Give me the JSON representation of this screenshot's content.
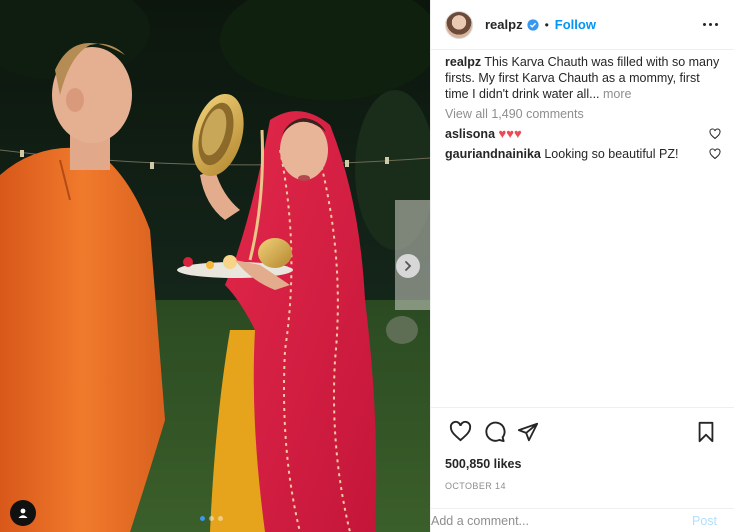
{
  "post": {
    "username": "realpz",
    "follow_label": "Follow",
    "separator": "•",
    "caption_user": "realpz",
    "caption_text": "This Karva Chauth was filled with so many firsts. My first Karva Chauth as a mommy, first time I didn't drink water all...",
    "caption_more": "more",
    "view_all_comments": "View all 1,490 comments",
    "comments": [
      {
        "user": "aslisona",
        "text": "♥♥♥"
      },
      {
        "user": "gauriandnainika",
        "text": "Looking so beautiful PZ!"
      }
    ],
    "likes": "500,850 likes",
    "date": "OCTOBER 14",
    "add_comment_placeholder": "Add a comment...",
    "post_label": "Post"
  },
  "carousel": {
    "total": 3,
    "active": 1
  },
  "colors": {
    "accent": "#0095f6",
    "heart": "#ed4956",
    "muted": "#8e8e8e"
  },
  "icons": [
    "verified-badge-icon",
    "more-options-icon",
    "heart-icon",
    "comment-icon",
    "share-icon",
    "bookmark-icon",
    "chevron-right-icon",
    "user-tag-icon"
  ]
}
